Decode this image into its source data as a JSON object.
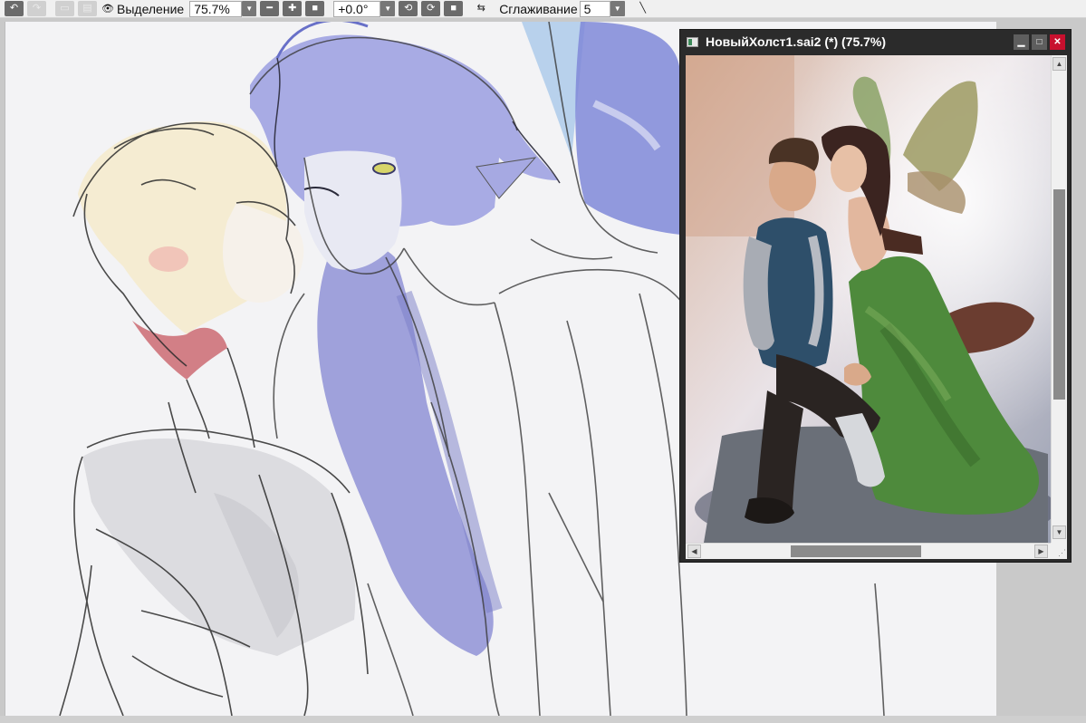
{
  "toolbar": {
    "undo_icon": "undo-icon",
    "redo_icon": "redo-icon",
    "selection_label": "Выделение",
    "zoom_value": "75.7%",
    "rotation_value": "+0.0°",
    "smoothing_label": "Сглаживание",
    "smoothing_value": "5"
  },
  "reference_window": {
    "title": "НовыйХолст1.sai2 (*) (75.7%)",
    "vertical_scroll_fraction": 0.29,
    "horizontal_scroll_fraction": 0.33
  },
  "colors": {
    "toolbar_bg": "#f0f0f0",
    "canvas_bg": "#f3f3f5",
    "window_frame": "#2b2b2b",
    "close_button": "#c8102e",
    "hair_blue": "#8f92d6",
    "hair_blonde": "#f2e6c8",
    "hair_tip_red": "#c9616a"
  }
}
